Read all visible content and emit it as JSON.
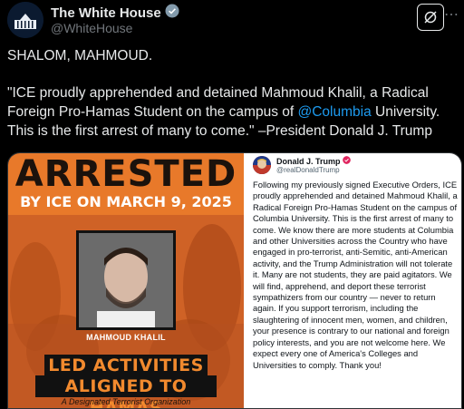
{
  "account": {
    "display_name": "The White House",
    "handle": "@WhiteHouse"
  },
  "tweet": {
    "line1": "SHALOM, MAHMOUD.",
    "quote_before": "\"ICE proudly apprehended and detained Mahmoud Khalil, a Radical Foreign Pro-Hamas Student on the campus of ",
    "mention": "@Columbia",
    "quote_after": " University. This is the first arrest of many to come.\" –President Donald J. Trump"
  },
  "poster": {
    "title": "ARRESTED",
    "subtitle": "BY ICE ON MARCH 9, 2025",
    "photo_caption": "MAHMOUD KHALIL",
    "bar1": "LED ACTIVITIES",
    "bar2": "ALIGNED TO HAMAS",
    "footer": "A Designated Terrorist Organization"
  },
  "truth_card": {
    "name": "Donald J. Trump",
    "handle": "@realDonaldTrump",
    "body": "Following my previously signed Executive Orders, ICE proudly apprehended and detained Mahmoud Khalil, a Radical Foreign Pro-Hamas Student on the campus of Columbia University. This is the first arrest of many to come. We know there are more students at Columbia and other Universities across the Country who have engaged in pro-terrorist, anti-Semitic, anti-American activity, and the Trump Administration will not tolerate it. Many are not students, they are paid agitators. We will find, apprehend, and deport these terrorist sympathizers from our country — never to return again. If you support terrorism, including the slaughtering of innocent men, women, and children, your presence is contrary to our national and foreign policy interests, and you are not welcome here. We expect every one of America's Colleges and Universities to comply. Thank you!"
  },
  "icons": [
    "white-house-avatar",
    "gray-verified-badge",
    "grok-icon",
    "more-icon",
    "verified-badge"
  ],
  "colors": {
    "background": "#000000",
    "text": "#e7e9ea",
    "muted": "#71767b",
    "link": "#1d9bf0",
    "poster_orange": "#e8792a"
  }
}
